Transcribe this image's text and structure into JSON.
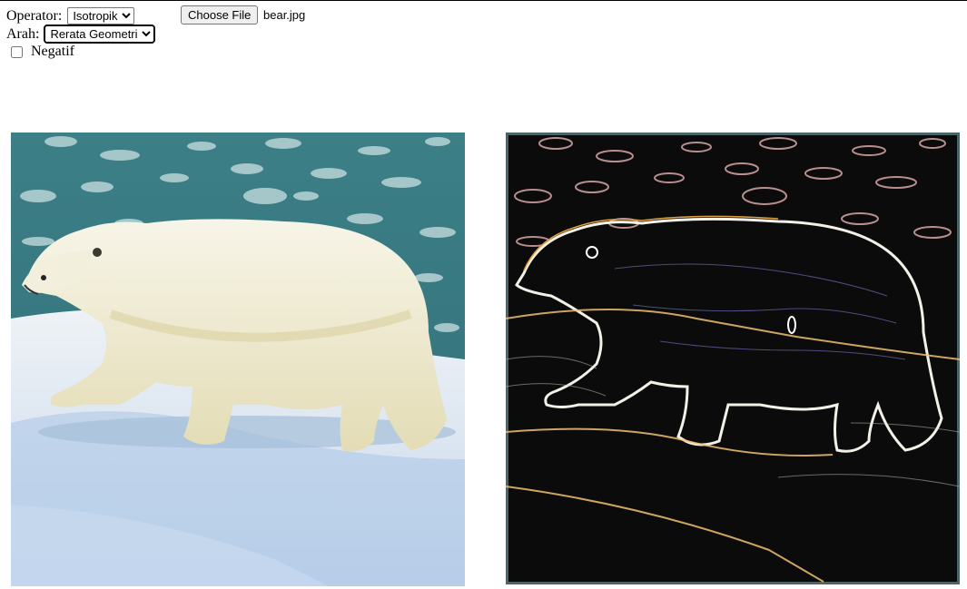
{
  "controls": {
    "operator_label": "Operator:",
    "operator_value": "Isotropik",
    "arah_label": "Arah:",
    "arah_value": "Rerata Geometri",
    "negatif_label": "Negatif",
    "negatif_checked": false,
    "file_button_label": "Choose File",
    "file_name": "bear.jpg"
  },
  "images": {
    "original": {
      "icon": "polar-bear-photo"
    },
    "processed": {
      "icon": "edge-detected-polar-bear"
    }
  }
}
